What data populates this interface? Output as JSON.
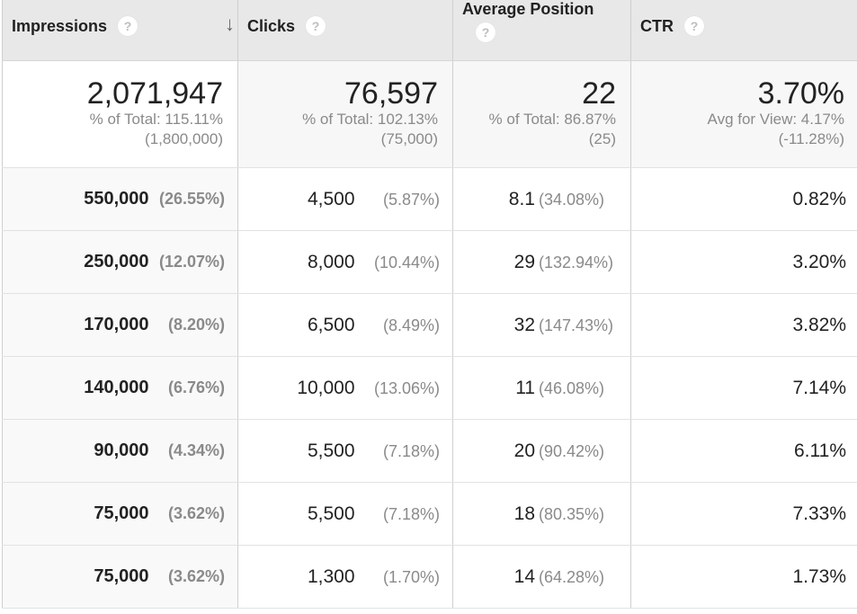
{
  "columns": [
    {
      "label": "Impressions",
      "help_icon": "question-circle-icon",
      "sorted": true,
      "sort_icon": "arrow-down-icon",
      "sort_glyph": "🡣"
    },
    {
      "label": "Clicks",
      "help_icon": "question-circle-icon"
    },
    {
      "label": "Average Position",
      "help_icon": "question-circle-icon"
    },
    {
      "label": "CTR",
      "help_icon": "question-circle-icon"
    }
  ],
  "help_glyph": "?",
  "totals": {
    "impressions": {
      "value": "2,071,947",
      "line1": "% of Total: 115.11%",
      "line2": "(1,800,000)"
    },
    "clicks": {
      "value": "76,597",
      "line1": "% of Total: 102.13%",
      "line2": "(75,000)"
    },
    "avg_position": {
      "value": "22",
      "line1": "% of Total: 86.87%",
      "line2": "(25)"
    },
    "ctr": {
      "value": "3.70%",
      "line1": "Avg for View: 4.17%",
      "line2": "(-11.28%)"
    }
  },
  "rows": [
    {
      "impressions": "550,000",
      "impressions_pct": "(26.55%)",
      "clicks": "4,500",
      "clicks_pct": "(5.87%)",
      "avg_position": "8.1",
      "avg_position_pct": "(34.08%)",
      "ctr": "0.82%"
    },
    {
      "impressions": "250,000",
      "impressions_pct": "(12.07%)",
      "clicks": "8,000",
      "clicks_pct": "(10.44%)",
      "avg_position": "29",
      "avg_position_pct": "(132.94%)",
      "ctr": "3.20%"
    },
    {
      "impressions": "170,000",
      "impressions_pct": "(8.20%)",
      "clicks": "6,500",
      "clicks_pct": "(8.49%)",
      "avg_position": "32",
      "avg_position_pct": "(147.43%)",
      "ctr": "3.82%"
    },
    {
      "impressions": "140,000",
      "impressions_pct": "(6.76%)",
      "clicks": "10,000",
      "clicks_pct": "(13.06%)",
      "avg_position": "11",
      "avg_position_pct": "(46.08%)",
      "ctr": "7.14%"
    },
    {
      "impressions": "90,000",
      "impressions_pct": "(4.34%)",
      "clicks": "5,500",
      "clicks_pct": "(7.18%)",
      "avg_position": "20",
      "avg_position_pct": "(90.42%)",
      "ctr": "6.11%"
    },
    {
      "impressions": "75,000",
      "impressions_pct": "(3.62%)",
      "clicks": "5,500",
      "clicks_pct": "(7.18%)",
      "avg_position": "18",
      "avg_position_pct": "(80.35%)",
      "ctr": "7.33%"
    },
    {
      "impressions": "75,000",
      "impressions_pct": "(3.62%)",
      "clicks": "1,300",
      "clicks_pct": "(1.70%)",
      "avg_position": "14",
      "avg_position_pct": "(64.28%)",
      "ctr": "1.73%"
    }
  ],
  "colors": {
    "header_bg": "#e8e8e8",
    "sorted_column_bg": "#f9f9f9",
    "secondary_text": "#8a8a8a",
    "primary_text": "#222222"
  }
}
